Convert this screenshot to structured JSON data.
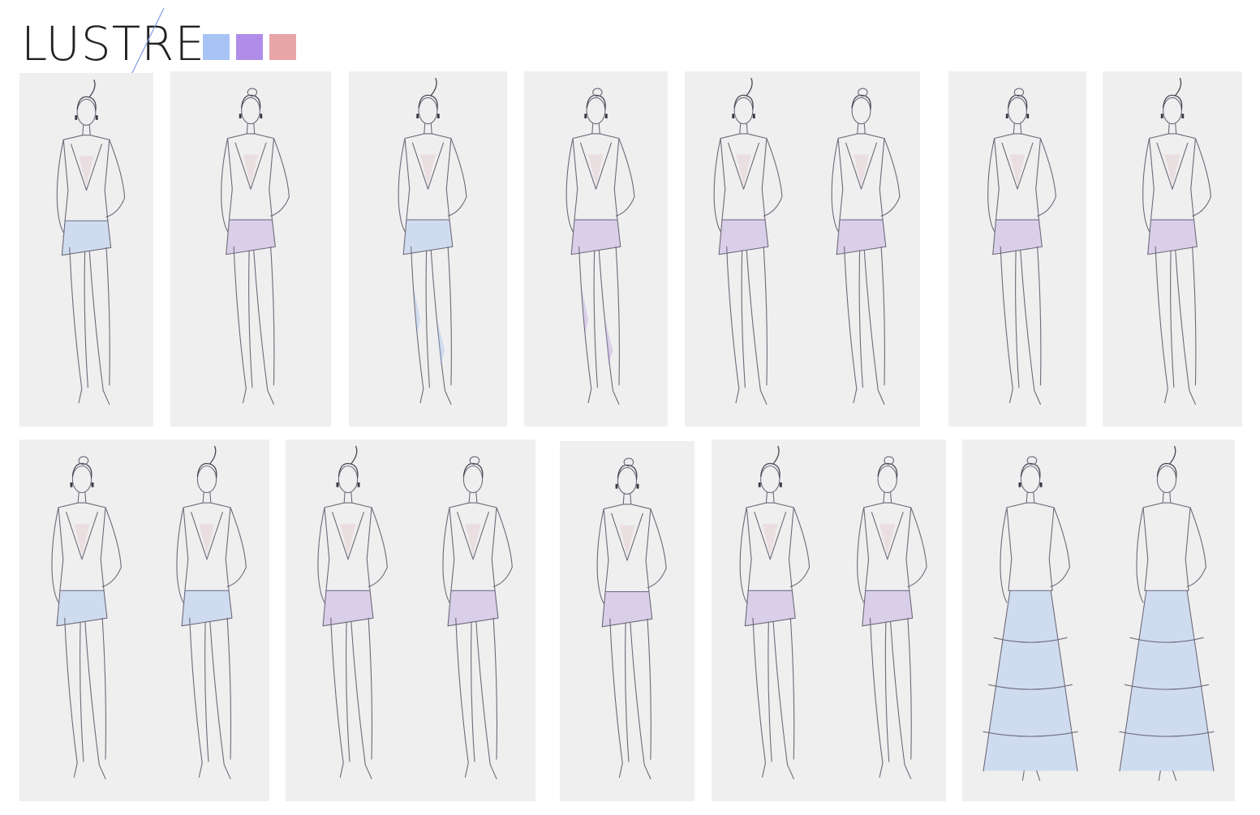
{
  "brand": {
    "title": "LUSTRE",
    "palette": [
      {
        "name": "blue",
        "color": "#a8c4f5"
      },
      {
        "name": "violet",
        "color": "#b08de8"
      },
      {
        "name": "rose",
        "color": "#e8a5a8"
      }
    ]
  },
  "panel_background": "#efefef",
  "rows": [
    {
      "panels": [
        {
          "figures": [
            "front"
          ],
          "garment": "top-shorts",
          "accent": "blue"
        },
        {
          "figures": [
            "front"
          ],
          "garment": "jacket-shorts",
          "accent": "violet"
        },
        {
          "figures": [
            "front"
          ],
          "garment": "corset-leggings",
          "accent": "blue"
        },
        {
          "figures": [
            "front"
          ],
          "garment": "asym-top-leggings",
          "accent": "violet"
        },
        {
          "figures": [
            "front",
            "back"
          ],
          "garment": "sleeve-romper",
          "accent": "violet"
        },
        {
          "figures": [
            "front"
          ],
          "garment": "wrap-peplum",
          "accent": "violet"
        },
        {
          "figures": [
            "front"
          ],
          "garment": "vest-peplum",
          "accent": "violet"
        }
      ]
    },
    {
      "panels": [
        {
          "figures": [
            "front",
            "back"
          ],
          "garment": "tunic-dress",
          "accent": "blue"
        },
        {
          "figures": [
            "front",
            "back"
          ],
          "garment": "one-shoulder-romper",
          "accent": "violet"
        },
        {
          "figures": [
            "front"
          ],
          "garment": "drape-dress",
          "accent": "violet"
        },
        {
          "figures": [
            "front",
            "back"
          ],
          "garment": "cutout-romper",
          "accent": "violet"
        },
        {
          "figures": [
            "front",
            "back"
          ],
          "garment": "tiered-gown",
          "accent": "blue"
        }
      ]
    }
  ]
}
